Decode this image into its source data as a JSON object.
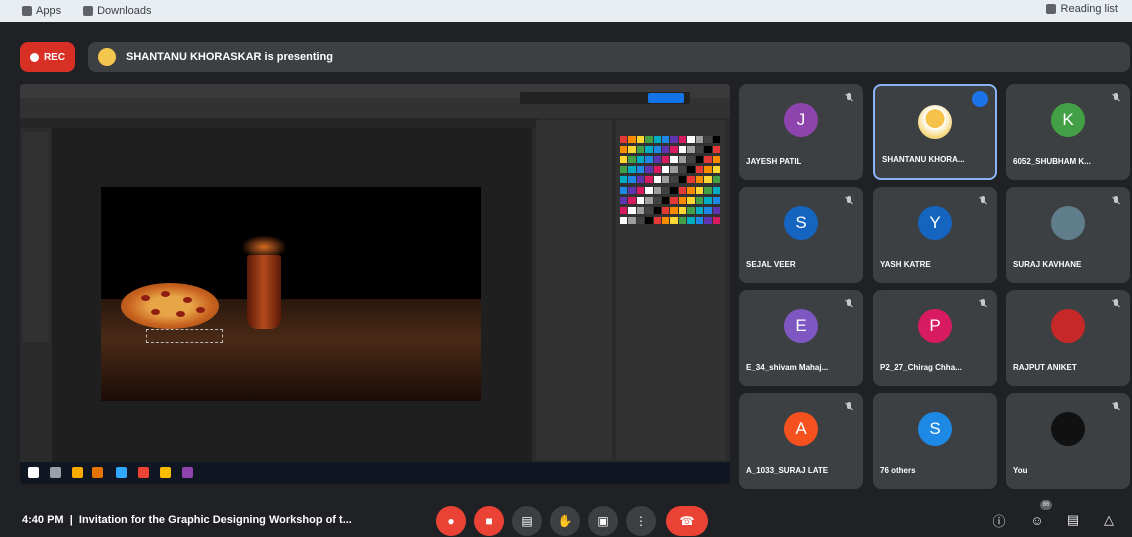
{
  "browser": {
    "apps_label": "Apps",
    "downloads_label": "Downloads",
    "reading_list_label": "Reading list"
  },
  "header": {
    "rec_label": "REC",
    "presenting_text": "SHANTANU KHORASKAR is presenting"
  },
  "participants": [
    {
      "name": "JAYESH PATIL",
      "initial": "J",
      "color": "#8e44ad",
      "muted": true
    },
    {
      "name": "SHANTANU KHORA...",
      "initial": "",
      "color": "#f6c24a",
      "muted": false,
      "presenting": true
    },
    {
      "name": "6052_SHUBHAM K...",
      "initial": "K",
      "color": "#43a047",
      "muted": true
    },
    {
      "name": "SEJAL VEER",
      "initial": "S",
      "color": "#1565c0",
      "muted": true
    },
    {
      "name": "YASH KATRE",
      "initial": "Y",
      "color": "#1565c0",
      "muted": true
    },
    {
      "name": "SURAJ KAVHANE",
      "initial": "",
      "color": "#607d8b",
      "muted": true
    },
    {
      "name": "E_34_shivam Mahaj...",
      "initial": "E",
      "color": "#7e57c2",
      "muted": true
    },
    {
      "name": "P2_27_Chirag Chha...",
      "initial": "P",
      "color": "#d81b60",
      "muted": true
    },
    {
      "name": "RAJPUT ANIKET",
      "initial": "",
      "color": "#c62828",
      "muted": true
    },
    {
      "name": "A_1033_SURAJ LATE",
      "initial": "A",
      "color": "#f4511e",
      "muted": true
    },
    {
      "name": "76 others",
      "initial": "S",
      "color": "#1e88e5",
      "muted": false
    },
    {
      "name": "You",
      "initial": "",
      "color": "#111111",
      "muted": true
    }
  ],
  "footer": {
    "time": "4:40 PM",
    "meeting_title": "Invitation for the Graphic Designing Workshop of t...",
    "people_badge": "86"
  }
}
